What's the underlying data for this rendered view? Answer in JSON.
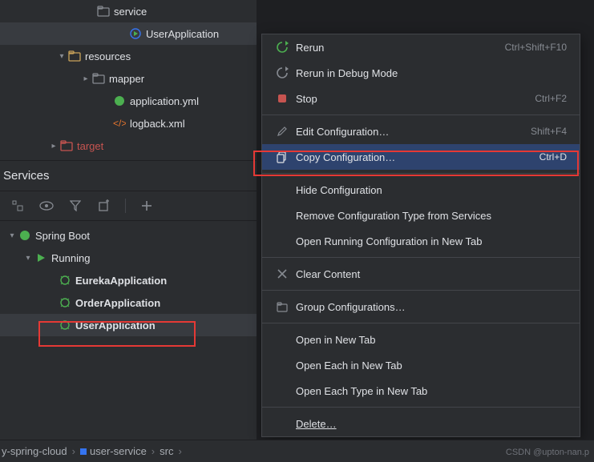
{
  "tree": {
    "service": "service",
    "user_app": "UserApplication",
    "resources": "resources",
    "mapper": "mapper",
    "app_yml": "application.yml",
    "logback": "logback.xml",
    "target": "target"
  },
  "panel": {
    "title": "Services"
  },
  "services": {
    "root": "Spring Boot",
    "running": "Running",
    "apps": [
      "EurekaApplication",
      "OrderApplication",
      "UserApplication"
    ]
  },
  "menu": {
    "rerun": {
      "label": "Rerun",
      "shortcut": "Ctrl+Shift+F10"
    },
    "debug": {
      "label": "Rerun in Debug Mode",
      "shortcut": ""
    },
    "stop": {
      "label": "Stop",
      "shortcut": "Ctrl+F2"
    },
    "edit": {
      "label": "Edit Configuration…",
      "shortcut": "Shift+F4"
    },
    "copy": {
      "label": "Copy Configuration…",
      "shortcut": "Ctrl+D"
    },
    "hide": {
      "label": "Hide Configuration"
    },
    "remove": {
      "label": "Remove Configuration Type from Services"
    },
    "open_tab": {
      "label": "Open Running Configuration in New Tab"
    },
    "clear": {
      "label": "Clear Content"
    },
    "group": {
      "label": "Group Configurations…"
    },
    "open_new": {
      "label": "Open in New Tab"
    },
    "open_each": {
      "label": "Open Each in New Tab"
    },
    "open_each_type": {
      "label": "Open Each Type in New Tab"
    },
    "delete": {
      "label": "Delete…"
    }
  },
  "breadcrumb": {
    "a": "y-spring-cloud",
    "b": "user-service",
    "c": "src"
  },
  "watermark": "CSDN @upton-nan.p"
}
